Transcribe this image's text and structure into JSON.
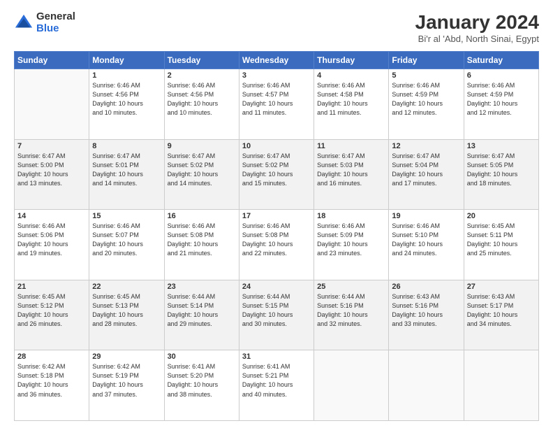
{
  "header": {
    "logo_general": "General",
    "logo_blue": "Blue",
    "title": "January 2024",
    "subtitle": "Bi'r al 'Abd, North Sinai, Egypt"
  },
  "days_of_week": [
    "Sunday",
    "Monday",
    "Tuesday",
    "Wednesday",
    "Thursday",
    "Friday",
    "Saturday"
  ],
  "weeks": [
    [
      {
        "day": "",
        "info": ""
      },
      {
        "day": "1",
        "info": "Sunrise: 6:46 AM\nSunset: 4:56 PM\nDaylight: 10 hours\nand 10 minutes."
      },
      {
        "day": "2",
        "info": "Sunrise: 6:46 AM\nSunset: 4:56 PM\nDaylight: 10 hours\nand 10 minutes."
      },
      {
        "day": "3",
        "info": "Sunrise: 6:46 AM\nSunset: 4:57 PM\nDaylight: 10 hours\nand 11 minutes."
      },
      {
        "day": "4",
        "info": "Sunrise: 6:46 AM\nSunset: 4:58 PM\nDaylight: 10 hours\nand 11 minutes."
      },
      {
        "day": "5",
        "info": "Sunrise: 6:46 AM\nSunset: 4:59 PM\nDaylight: 10 hours\nand 12 minutes."
      },
      {
        "day": "6",
        "info": "Sunrise: 6:46 AM\nSunset: 4:59 PM\nDaylight: 10 hours\nand 12 minutes."
      }
    ],
    [
      {
        "day": "7",
        "info": "Sunrise: 6:47 AM\nSunset: 5:00 PM\nDaylight: 10 hours\nand 13 minutes."
      },
      {
        "day": "8",
        "info": "Sunrise: 6:47 AM\nSunset: 5:01 PM\nDaylight: 10 hours\nand 14 minutes."
      },
      {
        "day": "9",
        "info": "Sunrise: 6:47 AM\nSunset: 5:02 PM\nDaylight: 10 hours\nand 14 minutes."
      },
      {
        "day": "10",
        "info": "Sunrise: 6:47 AM\nSunset: 5:02 PM\nDaylight: 10 hours\nand 15 minutes."
      },
      {
        "day": "11",
        "info": "Sunrise: 6:47 AM\nSunset: 5:03 PM\nDaylight: 10 hours\nand 16 minutes."
      },
      {
        "day": "12",
        "info": "Sunrise: 6:47 AM\nSunset: 5:04 PM\nDaylight: 10 hours\nand 17 minutes."
      },
      {
        "day": "13",
        "info": "Sunrise: 6:47 AM\nSunset: 5:05 PM\nDaylight: 10 hours\nand 18 minutes."
      }
    ],
    [
      {
        "day": "14",
        "info": "Sunrise: 6:46 AM\nSunset: 5:06 PM\nDaylight: 10 hours\nand 19 minutes."
      },
      {
        "day": "15",
        "info": "Sunrise: 6:46 AM\nSunset: 5:07 PM\nDaylight: 10 hours\nand 20 minutes."
      },
      {
        "day": "16",
        "info": "Sunrise: 6:46 AM\nSunset: 5:08 PM\nDaylight: 10 hours\nand 21 minutes."
      },
      {
        "day": "17",
        "info": "Sunrise: 6:46 AM\nSunset: 5:08 PM\nDaylight: 10 hours\nand 22 minutes."
      },
      {
        "day": "18",
        "info": "Sunrise: 6:46 AM\nSunset: 5:09 PM\nDaylight: 10 hours\nand 23 minutes."
      },
      {
        "day": "19",
        "info": "Sunrise: 6:46 AM\nSunset: 5:10 PM\nDaylight: 10 hours\nand 24 minutes."
      },
      {
        "day": "20",
        "info": "Sunrise: 6:45 AM\nSunset: 5:11 PM\nDaylight: 10 hours\nand 25 minutes."
      }
    ],
    [
      {
        "day": "21",
        "info": "Sunrise: 6:45 AM\nSunset: 5:12 PM\nDaylight: 10 hours\nand 26 minutes."
      },
      {
        "day": "22",
        "info": "Sunrise: 6:45 AM\nSunset: 5:13 PM\nDaylight: 10 hours\nand 28 minutes."
      },
      {
        "day": "23",
        "info": "Sunrise: 6:44 AM\nSunset: 5:14 PM\nDaylight: 10 hours\nand 29 minutes."
      },
      {
        "day": "24",
        "info": "Sunrise: 6:44 AM\nSunset: 5:15 PM\nDaylight: 10 hours\nand 30 minutes."
      },
      {
        "day": "25",
        "info": "Sunrise: 6:44 AM\nSunset: 5:16 PM\nDaylight: 10 hours\nand 32 minutes."
      },
      {
        "day": "26",
        "info": "Sunrise: 6:43 AM\nSunset: 5:16 PM\nDaylight: 10 hours\nand 33 minutes."
      },
      {
        "day": "27",
        "info": "Sunrise: 6:43 AM\nSunset: 5:17 PM\nDaylight: 10 hours\nand 34 minutes."
      }
    ],
    [
      {
        "day": "28",
        "info": "Sunrise: 6:42 AM\nSunset: 5:18 PM\nDaylight: 10 hours\nand 36 minutes."
      },
      {
        "day": "29",
        "info": "Sunrise: 6:42 AM\nSunset: 5:19 PM\nDaylight: 10 hours\nand 37 minutes."
      },
      {
        "day": "30",
        "info": "Sunrise: 6:41 AM\nSunset: 5:20 PM\nDaylight: 10 hours\nand 38 minutes."
      },
      {
        "day": "31",
        "info": "Sunrise: 6:41 AM\nSunset: 5:21 PM\nDaylight: 10 hours\nand 40 minutes."
      },
      {
        "day": "",
        "info": ""
      },
      {
        "day": "",
        "info": ""
      },
      {
        "day": "",
        "info": ""
      }
    ]
  ]
}
